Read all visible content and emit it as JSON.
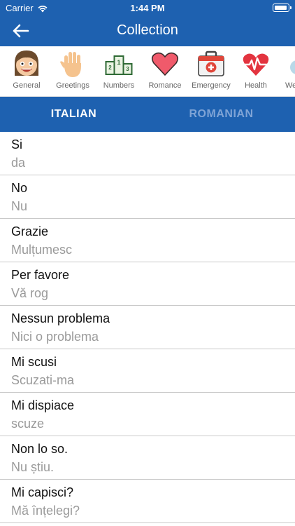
{
  "status": {
    "carrier": "Carrier",
    "time": "1:44 PM"
  },
  "nav": {
    "title": "Collection"
  },
  "categories": [
    {
      "label": "General",
      "icon": "smiling-face-icon"
    },
    {
      "label": "Greetings",
      "icon": "waving-hand-icon"
    },
    {
      "label": "Numbers",
      "icon": "podium-numbers-icon"
    },
    {
      "label": "Romance",
      "icon": "heart-icon"
    },
    {
      "label": "Emergency",
      "icon": "first-aid-kit-icon"
    },
    {
      "label": "Health",
      "icon": "heartbeat-icon"
    },
    {
      "label": "We",
      "icon": "weather-icon"
    }
  ],
  "tabs": {
    "source": "ITALIAN",
    "target": "ROMANIAN"
  },
  "phrases": [
    {
      "source": "Si",
      "target": "da"
    },
    {
      "source": "No",
      "target": "Nu"
    },
    {
      "source": "Grazie",
      "target": "Mulțumesc"
    },
    {
      "source": "Per favore",
      "target": "Vă rog"
    },
    {
      "source": "Nessun problema",
      "target": "Nici o problema"
    },
    {
      "source": "Mi scusi",
      "target": "Scuzati-ma"
    },
    {
      "source": "Mi dispiace",
      "target": "scuze"
    },
    {
      "source": "Non lo so.",
      "target": "Nu știu."
    },
    {
      "source": "Mi capisci?",
      "target": "Mă înțelegi?"
    }
  ],
  "colors": {
    "primary": "#1e61b0",
    "tab_inactive": "#7fa4d6",
    "secondary_text": "#9a9a9a"
  }
}
